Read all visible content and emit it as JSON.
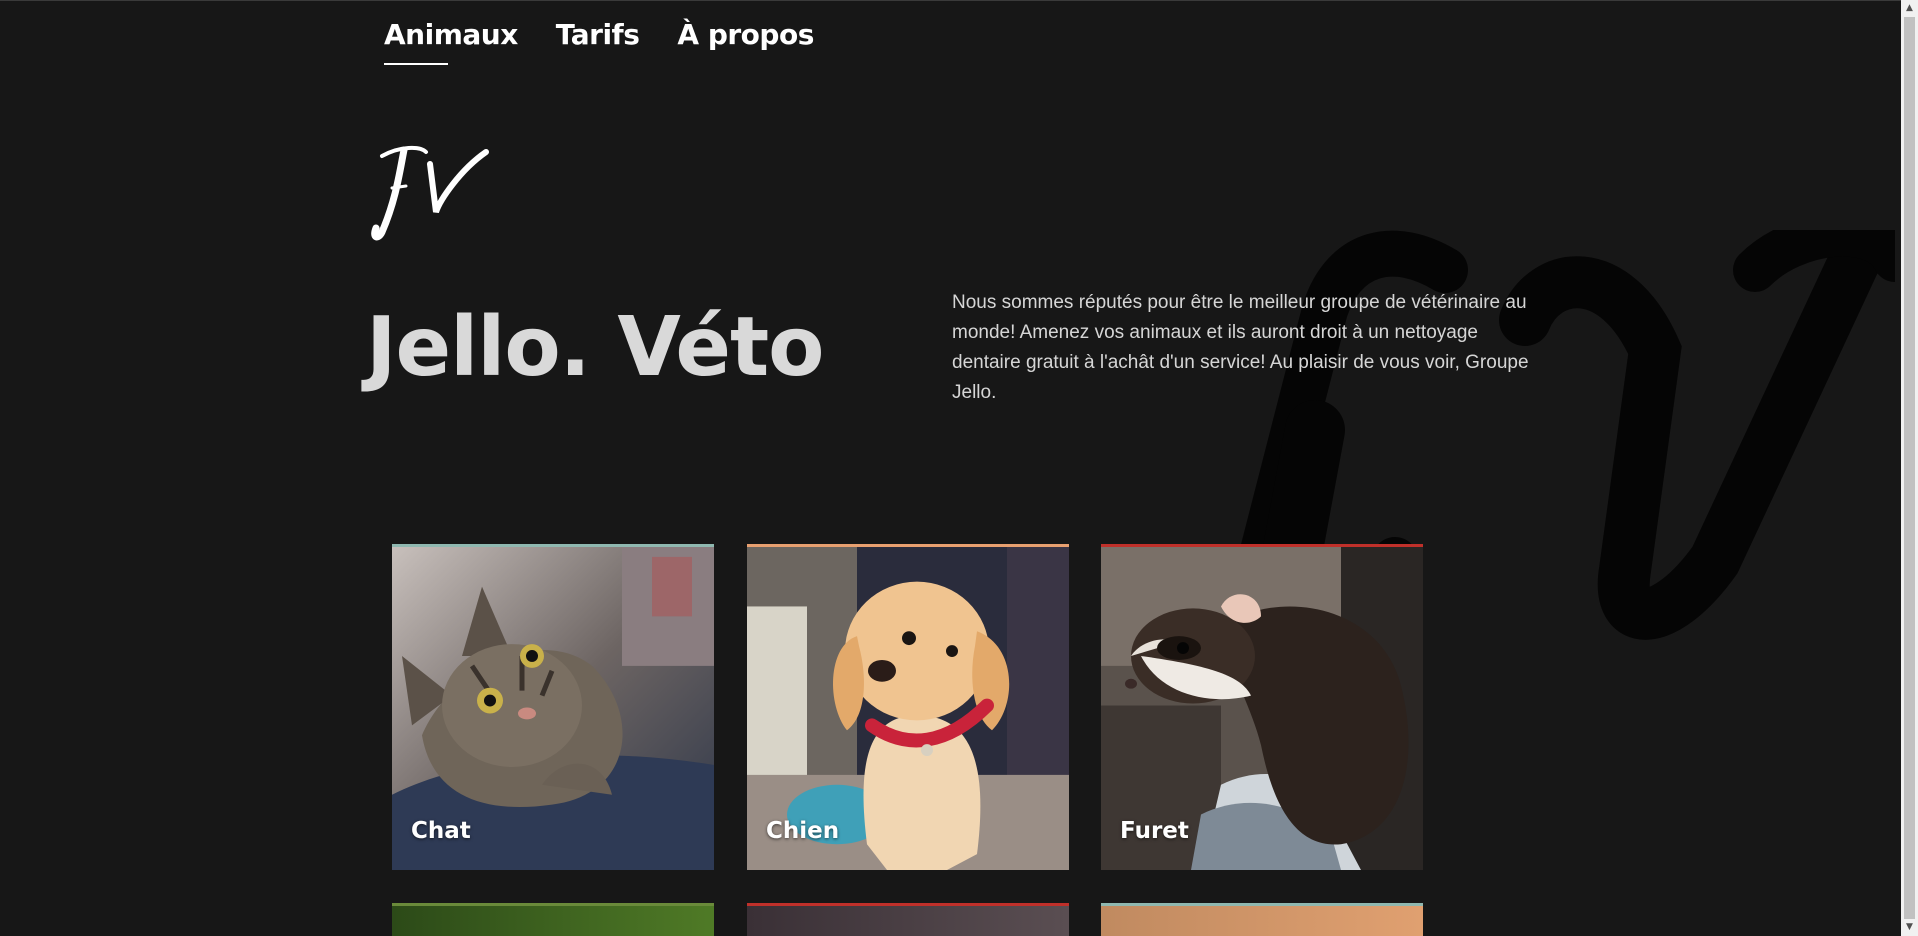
{
  "nav": {
    "items": [
      {
        "label": "Animaux",
        "active": true
      },
      {
        "label": "Tarifs",
        "active": false
      },
      {
        "label": "À propos",
        "active": false
      }
    ]
  },
  "hero": {
    "title": "Jello. Véto",
    "intro": "Nous sommes réputés pour être le meilleur groupe de vétérinaire au monde! Amenez vos animaux et ils auront droit à un nettoyage dentaire gratuit à l'achât d'un service! Au plaisir de vous voir, Groupe Jello."
  },
  "logo": {
    "icon": "jv-script-logo"
  },
  "animals": [
    {
      "label": "Chat",
      "accent": "#8fb8b0"
    },
    {
      "label": "Chien",
      "accent": "#e8a070"
    },
    {
      "label": "Furet",
      "accent": "#c0302a"
    }
  ],
  "more_animals_accents": [
    "#6a8a3a",
    "#c0302a",
    "#8fb8b0"
  ],
  "colors": {
    "background": "#171717",
    "title": "#d9d9d9",
    "text": "#d6d6d6"
  }
}
